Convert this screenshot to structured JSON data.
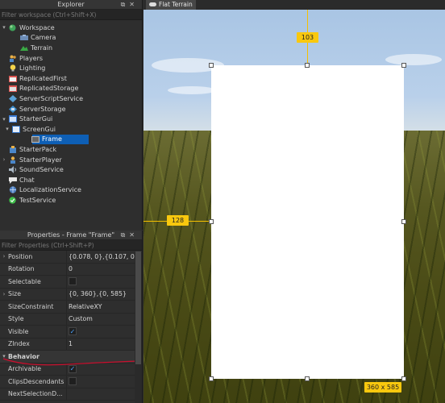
{
  "explorer": {
    "title": "Explorer",
    "filter_placeholder": "Filter workspace (Ctrl+Shift+X)",
    "items": [
      {
        "label": "Workspace",
        "icon": "workspace-globe-icon"
      },
      {
        "label": "Camera",
        "icon": "camera-icon"
      },
      {
        "label": "Terrain",
        "icon": "terrain-icon"
      },
      {
        "label": "Players",
        "icon": "players-icon"
      },
      {
        "label": "Lighting",
        "icon": "lighting-bulb-icon"
      },
      {
        "label": "ReplicatedFirst",
        "icon": "replicated-first-icon"
      },
      {
        "label": "ReplicatedStorage",
        "icon": "replicated-storage-icon"
      },
      {
        "label": "ServerScriptService",
        "icon": "server-script-service-icon"
      },
      {
        "label": "ServerStorage",
        "icon": "server-storage-icon"
      },
      {
        "label": "StarterGui",
        "icon": "starter-gui-icon"
      },
      {
        "label": "ScreenGui",
        "icon": "screen-gui-icon"
      },
      {
        "label": "Frame",
        "icon": "frame-icon"
      },
      {
        "label": "StarterPack",
        "icon": "starter-pack-icon"
      },
      {
        "label": "StarterPlayer",
        "icon": "starter-player-icon"
      },
      {
        "label": "SoundService",
        "icon": "sound-service-icon"
      },
      {
        "label": "Chat",
        "icon": "chat-icon"
      },
      {
        "label": "LocalizationService",
        "icon": "localization-service-icon"
      },
      {
        "label": "TestService",
        "icon": "test-service-icon"
      }
    ]
  },
  "properties": {
    "title": "Properties - Frame \"Frame\"",
    "filter_placeholder": "Filter Properties (Ctrl+Shift+P)",
    "rows": [
      {
        "name": "Position",
        "value": "{0.078, 0},{0.107, 0}"
      },
      {
        "name": "Rotation",
        "value": "0"
      },
      {
        "name": "Selectable",
        "value": ""
      },
      {
        "name": "Size",
        "value": "{0, 360},{0, 585}"
      },
      {
        "name": "SizeConstraint",
        "value": "RelativeXY"
      },
      {
        "name": "Style",
        "value": "Custom"
      },
      {
        "name": "Visible",
        "value": "✓"
      },
      {
        "name": "ZIndex",
        "value": "1"
      },
      {
        "name": "Behavior",
        "value": ""
      },
      {
        "name": "Archivable",
        "value": "✓"
      },
      {
        "name": "ClipsDescendants",
        "value": ""
      },
      {
        "name": "NextSelectionD...",
        "value": ""
      }
    ]
  },
  "viewport": {
    "tab_label": "Flat Terrain",
    "top_offset_label": "103",
    "left_offset_label": "128",
    "size_label": "360 x 585"
  },
  "colors": {
    "selection": "#0e5fb5",
    "guide": "#f9c80e",
    "annotation_stroke": "#c8102e"
  }
}
